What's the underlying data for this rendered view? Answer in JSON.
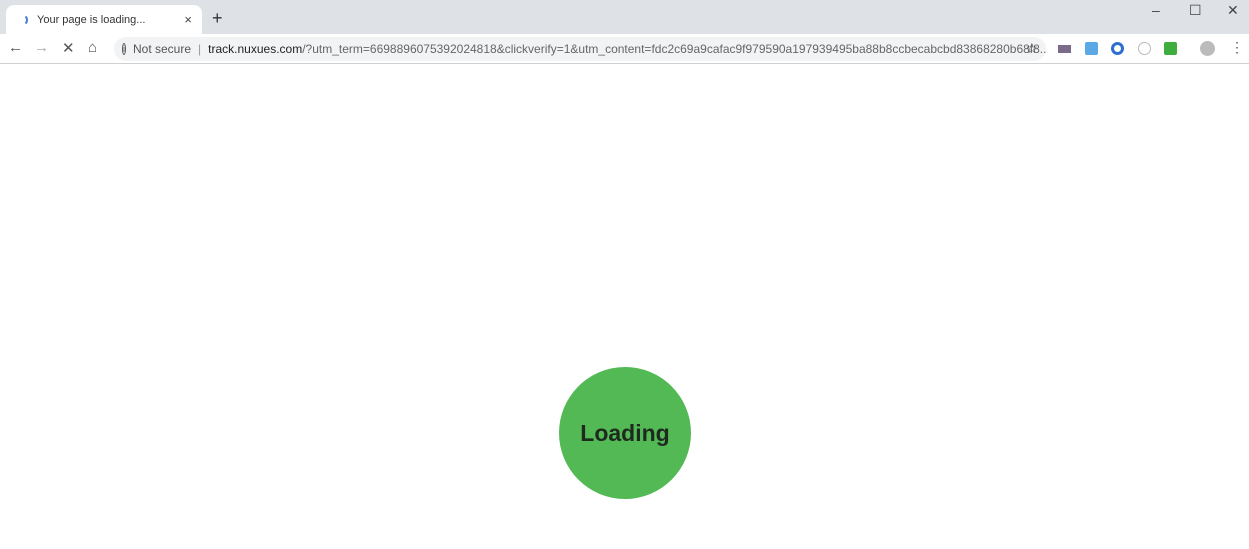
{
  "tab": {
    "title": "Your page is loading...",
    "close": "×",
    "new_tab": "+"
  },
  "window": {
    "minimize": "–",
    "maximize": "☐",
    "close": "✕"
  },
  "toolbar": {
    "back": "←",
    "forward": "→",
    "stop": "✕",
    "home": "⌂",
    "security_label": "Not secure",
    "url_host": "track.nuxues.com",
    "url_path": "/?utm_term=6698896075392024818&clickverify=1&utm_content=fdc2c69a9cafac9f979590a197939495ba88b8ccbecabcbd83868280b68f8...",
    "bookmark": "☆",
    "menu": "⋮"
  },
  "page": {
    "loading_label": "Loading",
    "accent": "#52b955"
  }
}
